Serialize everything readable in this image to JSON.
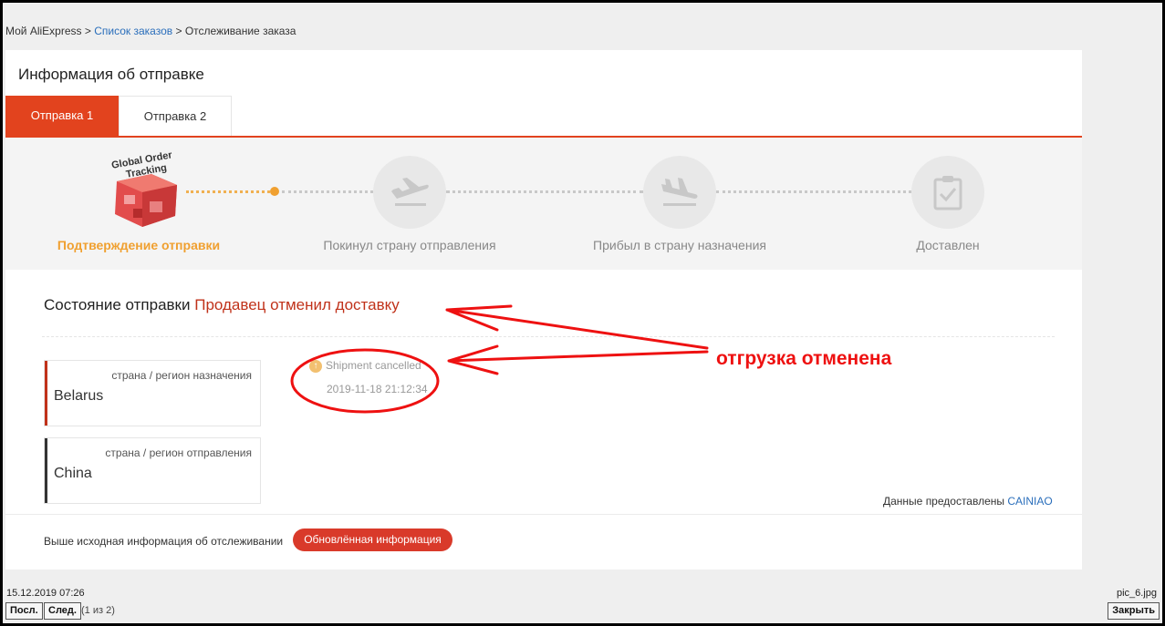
{
  "breadcrumb": {
    "root": "Мой AliExpress",
    "sep1": ">",
    "orders_link": "Список заказов",
    "sep2": ">",
    "current": "Отслеживание заказа"
  },
  "panel": {
    "title": "Информация об отправке"
  },
  "tabs": [
    {
      "label": "Отправка 1",
      "active": true
    },
    {
      "label": "Отправка 2",
      "active": false
    }
  ],
  "logo": {
    "line1": "Global Order",
    "line2": "Tracking"
  },
  "steps": [
    {
      "label": "Подтверждение отправки",
      "icon": "global-order-tracking-logo",
      "active": true
    },
    {
      "label": "Покинул страну отправления",
      "icon": "plane-departure-icon",
      "active": false
    },
    {
      "label": "Прибыл в страну назначения",
      "icon": "plane-arrival-icon",
      "active": false
    },
    {
      "label": "Доставлен",
      "icon": "clipboard-check-icon",
      "active": false
    }
  ],
  "status": {
    "label": "Состояние отправки",
    "value": "Продавец отменил доставку"
  },
  "destination": {
    "sublabel": "страна / регион назначения",
    "name": "Belarus"
  },
  "origin": {
    "sublabel": "страна / регион отправления",
    "name": "China"
  },
  "event": {
    "icon": "up-arrow-icon",
    "text": "Shipment cancelled",
    "time": "2019-11-18 21:12:34"
  },
  "provider": {
    "label": "Данные предоставлены",
    "name": "CAINIAO"
  },
  "footer": {
    "text": "Выше исходная информация об отслеживании",
    "button": "Обновлённая информация"
  },
  "annotation": {
    "text": "отгрузка отменена"
  },
  "viewer": {
    "date": "15.12.2019 07:26",
    "filename": "pic_6.jpg",
    "prev": "Посл.",
    "next": "След.",
    "page_info": "(1 из 2)",
    "close": "Закрыть"
  },
  "colors": {
    "accent": "#e2431e",
    "status": "#c0321a",
    "link": "#2a6ebb",
    "annotation": "#ee1111",
    "active_step": "#f0a030"
  }
}
